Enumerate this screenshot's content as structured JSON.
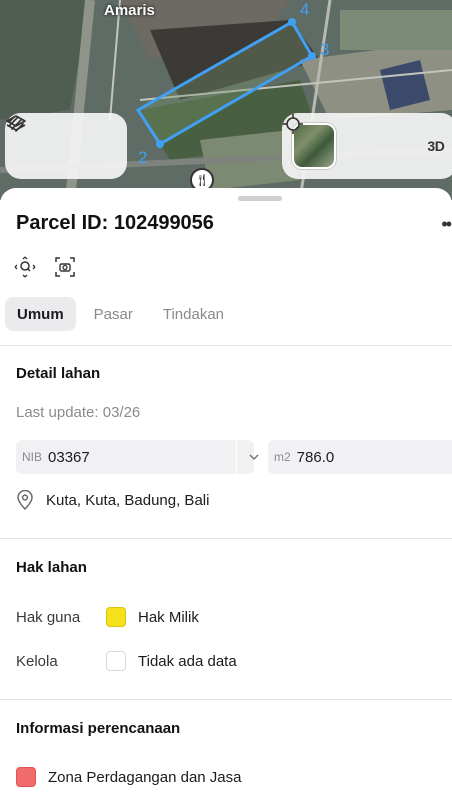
{
  "map": {
    "place_label": "Amaris",
    "vertex_labels": [
      "2",
      "3",
      "4"
    ],
    "parcel_outline_color": "#3fa0f4",
    "tools_left": [
      {
        "icon": "layers-icon"
      },
      {
        "icon": "draw-measure-icon"
      }
    ],
    "tools_right": [
      {
        "icon": "satellite-thumbnail"
      },
      {
        "icon": "crosshair-locate-icon"
      },
      {
        "label": "3D"
      }
    ],
    "poi_icon": "restaurant-icon"
  },
  "sheet": {
    "title": "Parcel ID: 102499056",
    "more_icon": "more-dots-icon",
    "action_icons": [
      "zoom-to-parcel-icon",
      "screenshot-camera-icon"
    ],
    "tabs": [
      {
        "label": "Umum",
        "active": true
      },
      {
        "label": "Pasar",
        "active": false
      },
      {
        "label": "Tindakan",
        "active": false
      }
    ],
    "detail": {
      "title": "Detail lahan",
      "last_update": "Last update: 03/26",
      "nib_prefix": "NIB",
      "nib_value": "03367",
      "area_prefix": "m2",
      "area_value": "786.0",
      "location": "Kuta, Kuta, Badung, Bali"
    },
    "rights": {
      "title": "Hak lahan",
      "rows": [
        {
          "key": "Hak guna",
          "value": "Hak Milik",
          "swatch": "#f6e21c"
        },
        {
          "key": "Kelola",
          "value": "Tidak ada data",
          "swatch": "#ffffff"
        }
      ]
    },
    "planning": {
      "title": "Informasi perencanaan",
      "zone": "Zona Perdagangan dan Jasa",
      "zone_color": "#f26b6b"
    }
  }
}
